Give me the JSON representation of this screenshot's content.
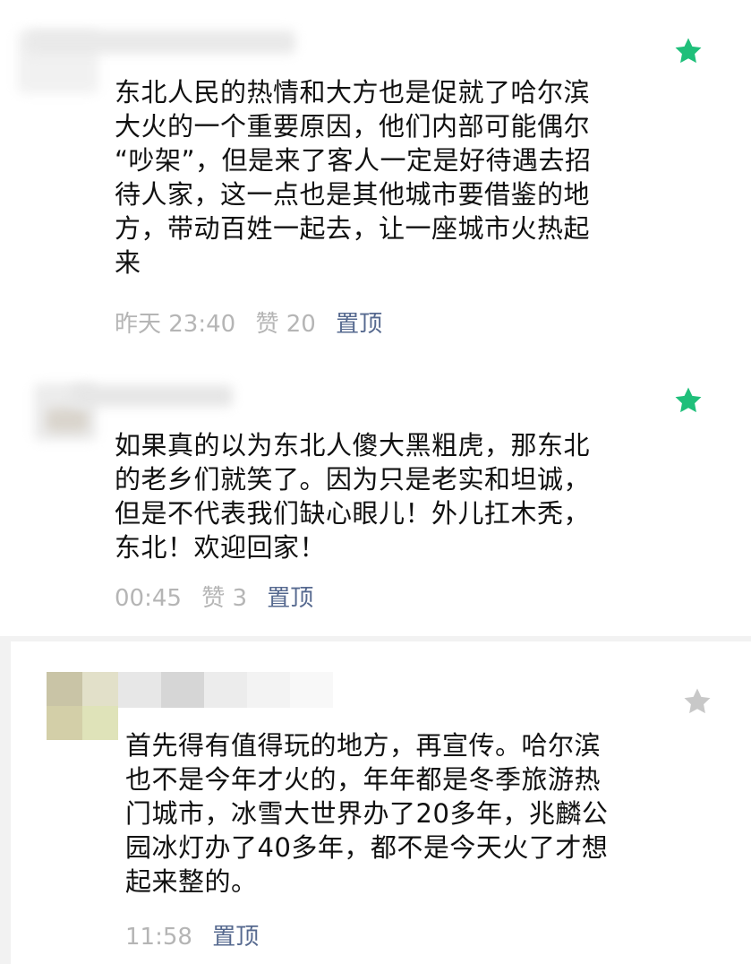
{
  "comments": [
    {
      "text": "东北人民的热情和大方也是促就了哈尔滨\n大火的一个重要原因，他们内部可能偶尔\n“吵架”，但是来了客人一定是好待遇去招\n待人家，这一点也是其他城市要借鉴的地\n方，带动百姓一起去，让一座城市火热起\n来",
      "time": "昨天 23:40",
      "likes": "赞 20",
      "pin_label": "置顶",
      "star": "filled-star-icon",
      "star_color": "#1fbf7a"
    },
    {
      "text": "如果真的以为东北人傻大黑粗虎，那东北\n的老乡们就笑了。因为只是老实和坦诚，\n但是不代表我们缺心眼儿！外儿扛木秃，\n东北！欢迎回家！",
      "time": "00:45",
      "likes": "赞 3",
      "pin_label": "置顶",
      "star": "filled-star-icon",
      "star_color": "#1fbf7a"
    },
    {
      "text": "首先得有值得玩的地方，再宣传。哈尔滨\n也不是今年才火的，年年都是冬季旅游热\n门城市，冰雪大世界办了20多年，兆麟公\n园冰灯办了40多年，都不是今天火了才想\n起来整的。",
      "time": "11:58",
      "pin_label": "置顶",
      "star": "outline-star-icon",
      "star_color": "#c8c8c8"
    }
  ],
  "colors": {
    "text": "#111111",
    "meta": "#b5b5b5",
    "pin": "#56698f",
    "seam": "#f2f2f2"
  }
}
